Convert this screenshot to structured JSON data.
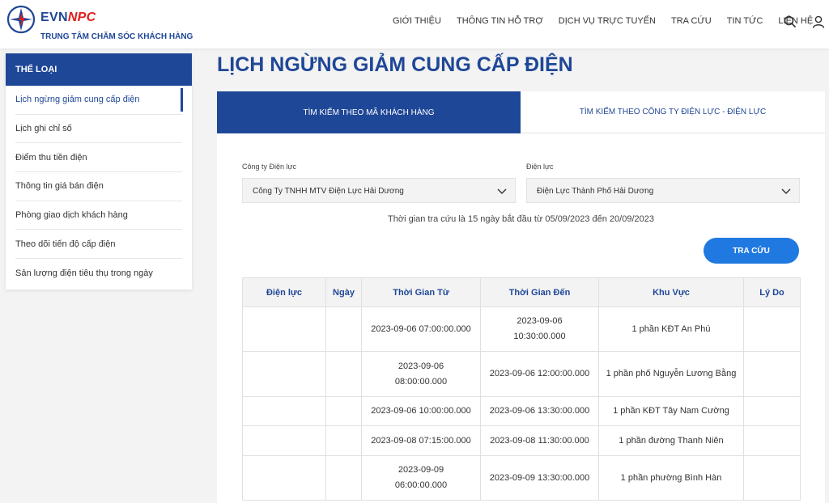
{
  "brand": {
    "name_evn": "EVN",
    "name_npc": "NPC",
    "subtitle": "TRUNG TÂM CHĂM SÓC KHÁCH HÀNG"
  },
  "nav": {
    "items": [
      "GIỚI THIỆU",
      "THÔNG TIN HỖ TRỢ",
      "DỊCH VỤ TRỰC TUYẾN",
      "TRA CỨU",
      "TIN TỨC",
      "LIÊN HỆ"
    ]
  },
  "sidebar": {
    "title": "THỂ LOẠI",
    "items": [
      "Lịch ngừng giảm cung cấp điện",
      "Lịch ghi chỉ số",
      "Điểm thu tiền điện",
      "Thông tin giá bán điện",
      "Phòng giao dịch khách hàng",
      "Theo dõi tiến độ cấp điện",
      "Sản lượng điện tiêu thụ trong ngày"
    ],
    "active_index": 0
  },
  "page_title": "LỊCH NGỪNG GIẢM CUNG CẤP ĐIỆN",
  "tabs": [
    "TÌM KIẾM THEO MÃ KHÁCH HÀNG",
    "TÌM KIẾM THEO CÔNG TY ĐIỆN LỰC - ĐIỆN LỰC"
  ],
  "form": {
    "company_label": "Công ty Điện lực",
    "company_value": "Công Ty TNHH MTV Điện Lực Hải Dương",
    "unit_label": "Điện lực",
    "unit_value": "Điện Lực Thành Phố Hải Dương",
    "range_note": "Thời gian tra cứu là 15 ngày bắt đầu từ 05/09/2023 đến 20/09/2023",
    "search_label": "TRA CỨU"
  },
  "table": {
    "headers": [
      "Điện lực",
      "Ngày",
      "Thời Gian Từ",
      "Thời Gian Đến",
      "Khu Vực",
      "Lý Do"
    ],
    "rows": [
      [
        "",
        "",
        "2023-09-06 07:00:00.000",
        "2023-09-06 10:30:00.000",
        "1 phần KĐT An Phú",
        ""
      ],
      [
        "",
        "",
        "2023-09-06 08:00:00.000",
        "2023-09-06 12:00:00.000",
        "1 phần phố Nguyễn Lương Bằng",
        ""
      ],
      [
        "",
        "",
        "2023-09-06 10:00:00.000",
        "2023-09-06 13:30:00.000",
        "1 phần KĐT Tây Nam Cường",
        ""
      ],
      [
        "",
        "",
        "2023-09-08 07:15:00.000",
        "2023-09-08 11:30:00.000",
        "1 phần đường Thanh Niên",
        ""
      ],
      [
        "",
        "",
        "2023-09-09 06:00:00.000",
        "2023-09-09 13:30:00.000",
        "1 phần phường Bình Hàn",
        ""
      ]
    ]
  },
  "icons": {
    "search": "search-icon",
    "user": "user-icon",
    "chevron": "chevron-down-icon"
  },
  "colors": {
    "primary": "#1f4797",
    "accent_red": "#e31d1a",
    "button": "#1f79e0"
  }
}
